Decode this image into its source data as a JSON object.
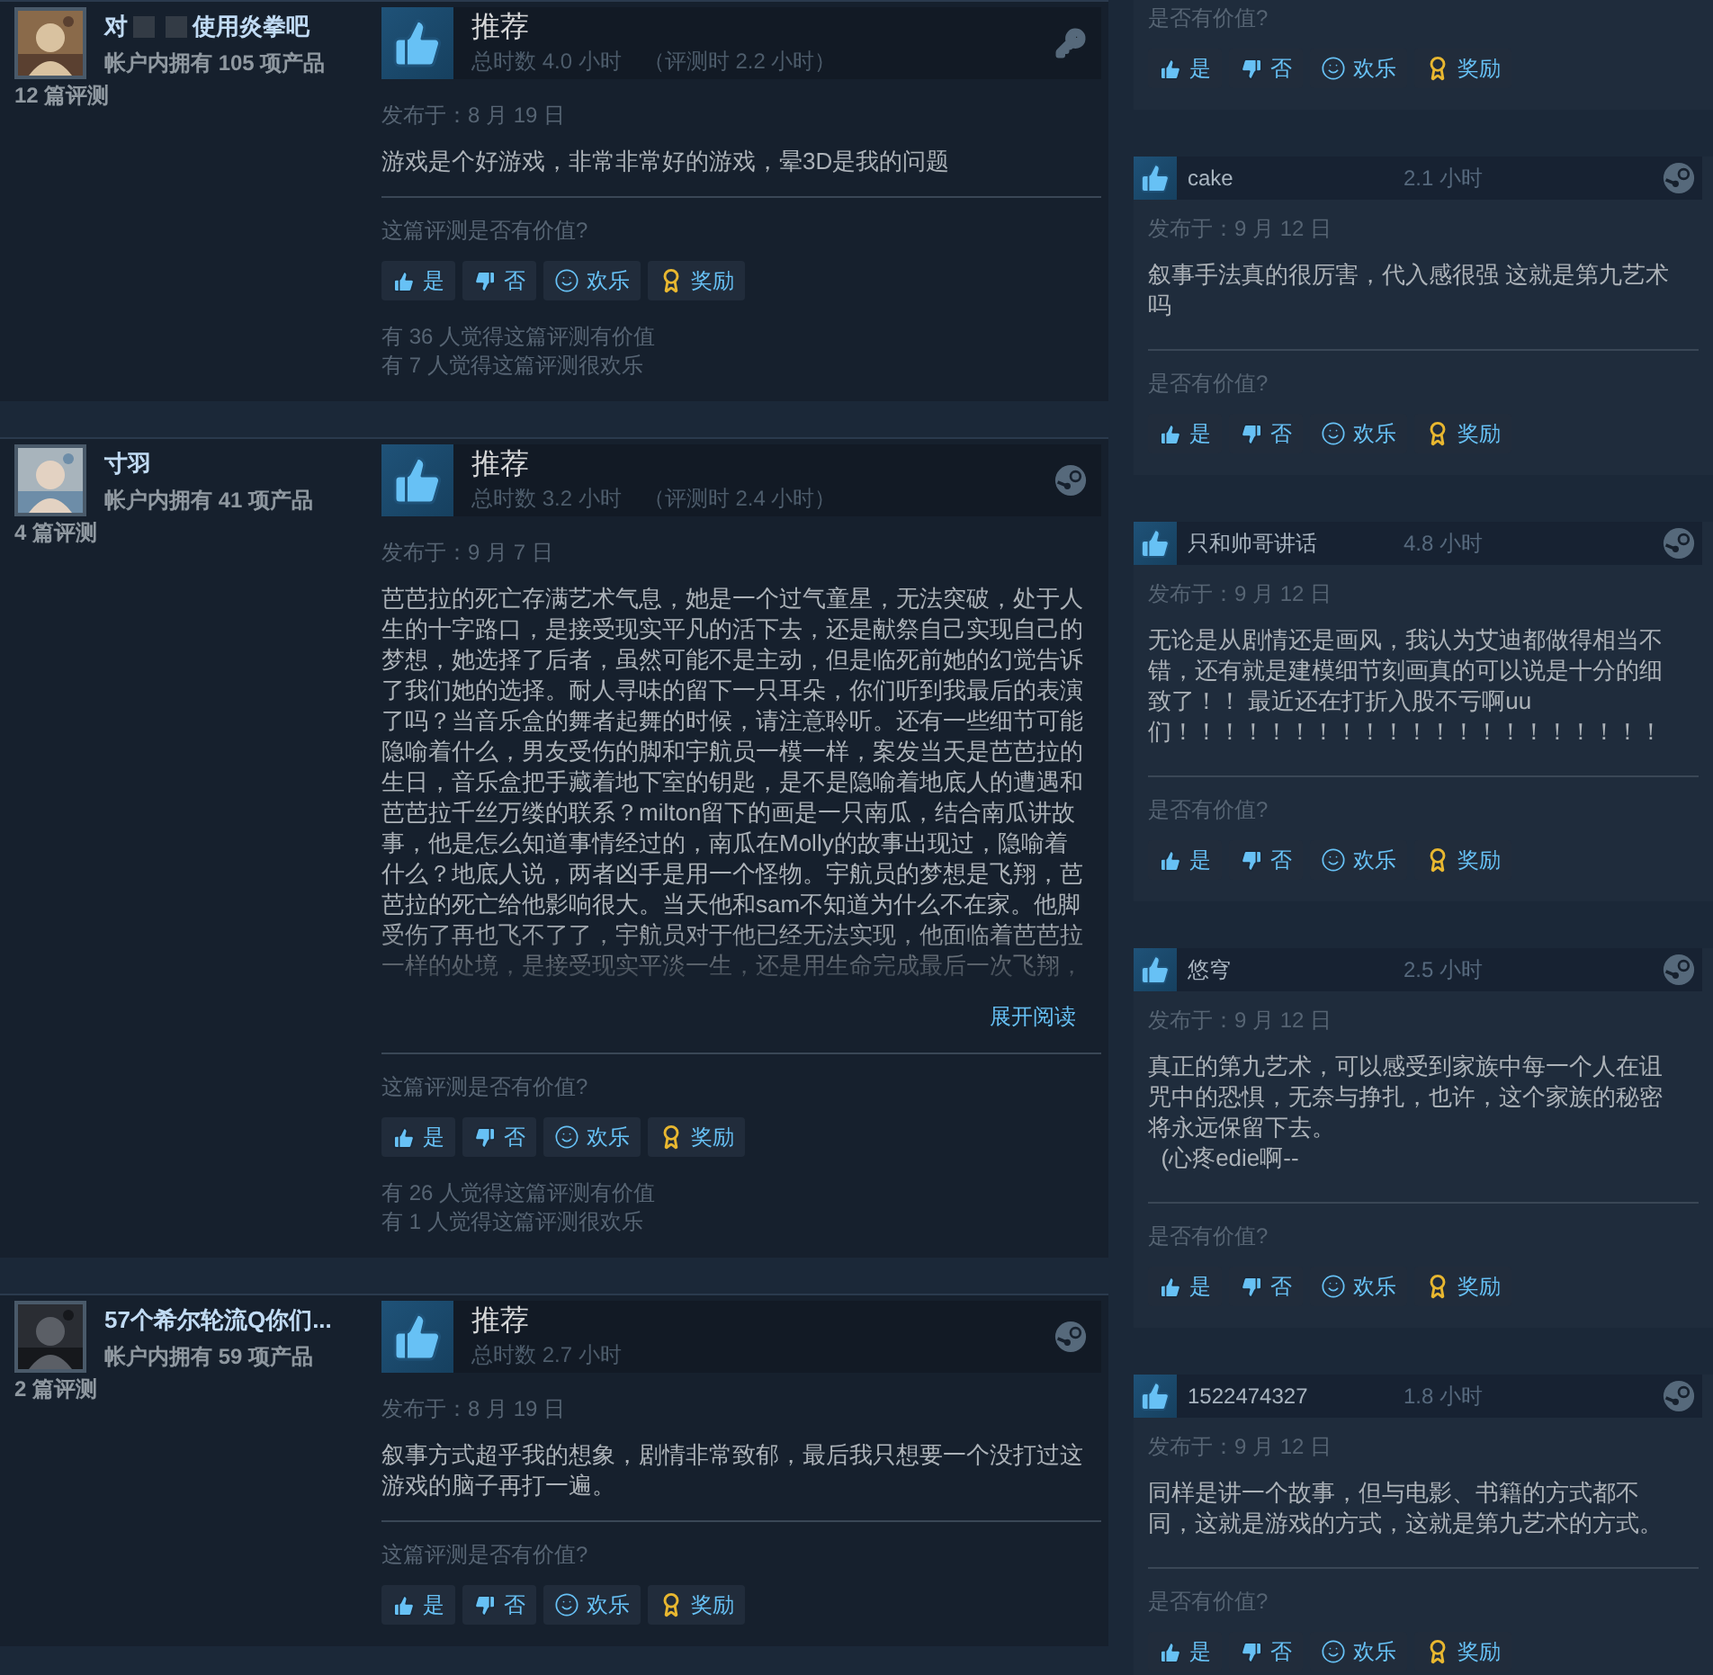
{
  "reviews": [
    {
      "author": {
        "name": [
          {
            "kind": "text",
            "text": "对"
          },
          {
            "kind": "redacted"
          },
          {
            "kind": "redacted"
          },
          {
            "kind": "text",
            "text": "使用炎拳吧"
          }
        ],
        "products": "帐户内拥有 105 项产品",
        "review_count": "12 篇评测"
      },
      "verdict": "推荐",
      "hours": "总时数 4.0 小时",
      "review_hours": "（评测时 2.2 小时）",
      "kind": "key",
      "posted": "发布于：8 月 19 日",
      "body": "游戏是个好游戏，非常非常好的游戏，晕3D是我的问题",
      "prompt": "这篇评测是否有价值?",
      "buttons": [
        {
          "kind": "yes",
          "label": "是"
        },
        {
          "kind": "no",
          "label": "否"
        },
        {
          "kind": "funny",
          "label": "欢乐"
        },
        {
          "kind": "award",
          "label": "奖励"
        }
      ],
      "stats": [
        "有 36 人觉得这篇评测有价值",
        "有 7 人觉得这篇评测很欢乐"
      ]
    },
    {
      "author": {
        "name": [
          {
            "kind": "text",
            "text": "寸羽"
          }
        ],
        "products": "帐户内拥有 41 项产品",
        "review_count": "4 篇评测"
      },
      "verdict": "推荐",
      "hours": "总时数 3.2 小时",
      "review_hours": "（评测时 2.4 小时）",
      "kind": "steam",
      "posted": "发布于：9 月 7 日",
      "body": "芭芭拉的死亡存满艺术气息，她是一个过气童星，无法突破，处于人生的十字路口，是接受现实平凡的活下去，还是献祭自己实现自己的梦想，她选择了后者，虽然可能不是主动，但是临死前她的幻觉告诉了我们她的选择。耐人寻味的留下一只耳朵，你们听到我最后的表演了吗？当音乐盒的舞者起舞的时候，请注意聆听。还有一些细节可能隐喻着什么，男友受伤的脚和宇航员一模一样，案发当天是芭芭拉的生日，音乐盒把手藏着地下室的钥匙，是不是隐喻着地底人的遭遇和芭芭拉千丝万缕的联系？milton留下的画是一只南瓜，结合南瓜讲故事，他是怎么知道事情经过的，南瓜在Molly的故事出现过，隐喻着什么？地底人说，两者凶手是用一个怪物。宇航员的梦想是飞翔，芭芭拉的死亡给他影响很大。当天他和sam不知道为什么不在家。他脚受伤了再也飞不了了，宇航员对于他已经无法实现，他面临着芭芭拉一样的处境，是接受现实平淡一生，还是用生命完成最后一次飞翔，",
      "collapsed": true,
      "expand": "展开阅读",
      "prompt": "这篇评测是否有价值?",
      "buttons": [
        {
          "kind": "yes",
          "label": "是"
        },
        {
          "kind": "no",
          "label": "否"
        },
        {
          "kind": "funny",
          "label": "欢乐"
        },
        {
          "kind": "award",
          "label": "奖励"
        }
      ],
      "stats": [
        "有 26 人觉得这篇评测有价值",
        "有 1 人觉得这篇评测很欢乐"
      ]
    },
    {
      "author": {
        "name": [
          {
            "kind": "text",
            "text": "57个希尔轮流Q你们..."
          }
        ],
        "products": "帐户内拥有 59 项产品",
        "review_count": "2 篇评测"
      },
      "verdict": "推荐",
      "hours": "总时数 2.7 小时",
      "kind": "steam",
      "posted": "发布于：8 月 19 日",
      "body": "叙事方式超乎我的想象，剧情非常致郁，最后我只想要一个没打过这游戏的脑子再打一遍。",
      "prompt": "这篇评测是否有价值?",
      "buttons": [
        {
          "kind": "yes",
          "label": "是"
        },
        {
          "kind": "no",
          "label": "否"
        },
        {
          "kind": "funny",
          "label": "欢乐"
        },
        {
          "kind": "award",
          "label": "奖励"
        }
      ]
    }
  ],
  "side": {
    "partial": {
      "prompt": "是否有价值?",
      "buttons": [
        {
          "kind": "yes",
          "label": "是"
        },
        {
          "kind": "no",
          "label": "否"
        },
        {
          "kind": "funny",
          "label": "欢乐"
        },
        {
          "kind": "award",
          "label": "奖励"
        }
      ]
    },
    "reviews": [
      {
        "name": "cake",
        "hours": "2.1 小时",
        "posted": "发布于：9 月 12 日",
        "body": "叙事手法真的很厉害，代入感很强 这就是第九艺术吗",
        "prompt": "是否有价值?",
        "buttons": [
          {
            "kind": "yes",
            "label": "是"
          },
          {
            "kind": "no",
            "label": "否"
          },
          {
            "kind": "funny",
            "label": "欢乐"
          },
          {
            "kind": "award",
            "label": "奖励"
          }
        ]
      },
      {
        "name": "只和帅哥讲话",
        "hours": "4.8 小时",
        "posted": "发布于：9 月 12 日",
        "body": "无论是从剧情还是画风，我认为艾迪都做得相当不错，还有就是建模细节刻画真的可以说是十分的细致了！！ 最近还在打折入股不亏啊uu们！！！！！！！！！！！！！！！！！！！！！",
        "prompt": "是否有价值?",
        "buttons": [
          {
            "kind": "yes",
            "label": "是"
          },
          {
            "kind": "no",
            "label": "否"
          },
          {
            "kind": "funny",
            "label": "欢乐"
          },
          {
            "kind": "award",
            "label": "奖励"
          }
        ]
      },
      {
        "name": "悠穹",
        "hours": "2.5 小时",
        "posted": "发布于：9 月 12 日",
        "body": "真正的第九艺术，可以感受到家族中每一个人在诅咒中的恐惧，无奈与挣扎，也许，这个家族的秘密将永远保留下去。\n  (心疼edie啊--",
        "prompt": "是否有价值?",
        "buttons": [
          {
            "kind": "yes",
            "label": "是"
          },
          {
            "kind": "no",
            "label": "否"
          },
          {
            "kind": "funny",
            "label": "欢乐"
          },
          {
            "kind": "award",
            "label": "奖励"
          }
        ]
      },
      {
        "name": "1522474327",
        "hours": "1.8 小时",
        "posted": "发布于：9 月 12 日",
        "body": "同样是讲一个故事，但与电影、书籍的方式都不同，这就是游戏的方式，这就是第九艺术的方式。",
        "prompt": "是否有价值?",
        "buttons": [
          {
            "kind": "yes",
            "label": "是"
          },
          {
            "kind": "no",
            "label": "否"
          },
          {
            "kind": "funny",
            "label": "欢乐"
          },
          {
            "kind": "award",
            "label": "奖励"
          }
        ]
      }
    ]
  }
}
